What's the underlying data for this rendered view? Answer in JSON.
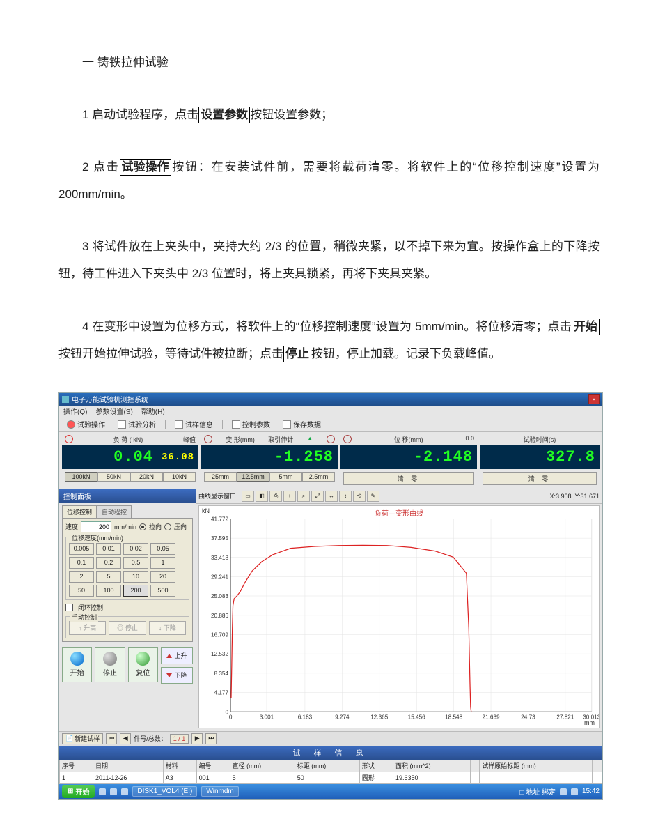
{
  "doc": {
    "heading": "一  铸铁拉伸试验",
    "p1_a": "1  启动试验程序，点击",
    "p1_box": "设置参数",
    "p1_b": "按钮设置参数；",
    "p2_a": "2  点击",
    "p2_box": "试验操作",
    "p2_b": "按钮：在安装试件前，需要将载荷清零。将软件上的“位移控制速度”设置为 200mm/min。",
    "p3": "3  将试件放在上夹头中，夹持大约 2/3 的位置，稍微夹紧，以不掉下来为宜。按操作盒上的下降按钮，待工件进入下夹头中 2/3 位置时，将上夹具锁紧，再将下夹具夹紧。",
    "p4_a": "4  在变形中设置为位移方式，将软件上的“位移控制速度”设置为 5mm/min。将位移清零；点击",
    "p4_box1": "开始",
    "p4_b": "按钮开始拉伸试验，等待试件被拉断；点击",
    "p4_box2": "停止",
    "p4_c": "按钮，停止加载。记录下负载峰值。"
  },
  "app": {
    "title": "电子万能试验机测控系统",
    "menus": [
      "操作(Q)",
      "参数设置(S)",
      "帮助(H)"
    ],
    "toolbar": {
      "ops": "试验操作",
      "ana": "试验分析",
      "info": "试样信息",
      "ctrl": "控制参数",
      "save": "保存数据"
    },
    "readouts": {
      "load": {
        "label": "负   荷 ( kN)",
        "sub": "峰值",
        "value": "0.04",
        "peak": "36.08",
        "ranges": [
          "100kN",
          "50kN",
          "20kN",
          "10kN"
        ]
      },
      "def": {
        "label": "变   形(mm)",
        "sub": "取引伸计",
        "value": "-1.258",
        "ranges": [
          "25mm",
          "12.5mm",
          "5mm",
          "2.5mm"
        ]
      },
      "disp": {
        "label": "位   移(mm)",
        "sub": "0.0",
        "value": "-2.148",
        "clear": "清   零"
      },
      "time": {
        "label": "试验时间(s)",
        "value": "327.8",
        "clear": "清   零"
      }
    },
    "leftpanel": {
      "title": "控制面板",
      "tabs": [
        "位移控制",
        "自动程控"
      ],
      "speed_label": "速度",
      "speed_value": "200",
      "speed_unit": "mm/min",
      "dir_pull": "拉向",
      "dir_push": "压向",
      "fs_title": "位移速度(mm/min)",
      "presets": [
        "0.005",
        "0.01",
        "0.02",
        "0.05",
        "0.1",
        "0.2",
        "0.5",
        "1",
        "2",
        "5",
        "10",
        "20",
        "50",
        "100",
        "200",
        "500"
      ],
      "closed_loop": "闭环控制",
      "manual_title": "手动控制",
      "mbtns": [
        "↑ 升高",
        "◎ 停止",
        "↓ 下降"
      ],
      "big": {
        "start": "开始",
        "stop": "停止",
        "reset": "复位",
        "up": "上升",
        "down": "下降"
      }
    },
    "chart": {
      "toolbar_label": "曲线显示窗口",
      "title": "负荷—变形曲线",
      "ylabel": "kN",
      "xlabel": "mm",
      "coord": "X:3.908 ,Y:31.671"
    },
    "sample": {
      "add": "新建试样",
      "nav_label": "件号/总数：",
      "nav_value": "1 / 1",
      "bar": "试 样 信 息",
      "cols": [
        "序号",
        "日期",
        "材料",
        "编号",
        "直径 (mm)",
        "标距 (mm)",
        "形状",
        "面积 (mm^2)",
        "",
        "试样原始标距 (mm)",
        ""
      ],
      "row": [
        "1",
        "2011-12-26",
        "A3",
        "001",
        "5",
        "50",
        "圆形",
        "19.6350",
        "",
        "",
        ""
      ]
    },
    "taskbar": {
      "start": "开始",
      "items": [
        "DISK1_VOL4 (E:)",
        "Winmdm"
      ],
      "tray": "□ 地址 绑定",
      "time": "15:42"
    }
  },
  "chart_data": {
    "type": "line",
    "title": "负荷—变形曲线",
    "xlabel": "mm",
    "ylabel": "kN",
    "xlim": [
      0,
      30.013
    ],
    "ylim": [
      0,
      41.772
    ],
    "xticks": [
      0,
      3.001,
      6.183,
      9.274,
      12.365,
      15.456,
      18.548,
      21.639,
      24.73,
      27.821,
      30.013
    ],
    "yticks": [
      0,
      4.177,
      8.354,
      12.532,
      16.709,
      20.886,
      25.083,
      29.241,
      33.418,
      37.595,
      41.772
    ],
    "series": [
      {
        "name": "负荷",
        "color": "#d22",
        "x": [
          0.05,
          0.1,
          0.15,
          0.2,
          0.3,
          0.5,
          0.8,
          1.2,
          1.8,
          2.6,
          3.5,
          5.0,
          7.0,
          9.0,
          11.0,
          13.0,
          15.0,
          17.0,
          18.5,
          19.6,
          19.8,
          19.9,
          19.95,
          20.0
        ],
        "y": [
          3.0,
          10.0,
          18.0,
          23.0,
          24.5,
          25.0,
          26.0,
          28.0,
          30.5,
          32.5,
          34.0,
          35.4,
          35.8,
          36.0,
          36.05,
          36.0,
          35.6,
          34.8,
          33.5,
          30.0,
          18.0,
          6.0,
          1.0,
          0.04
        ]
      }
    ]
  }
}
